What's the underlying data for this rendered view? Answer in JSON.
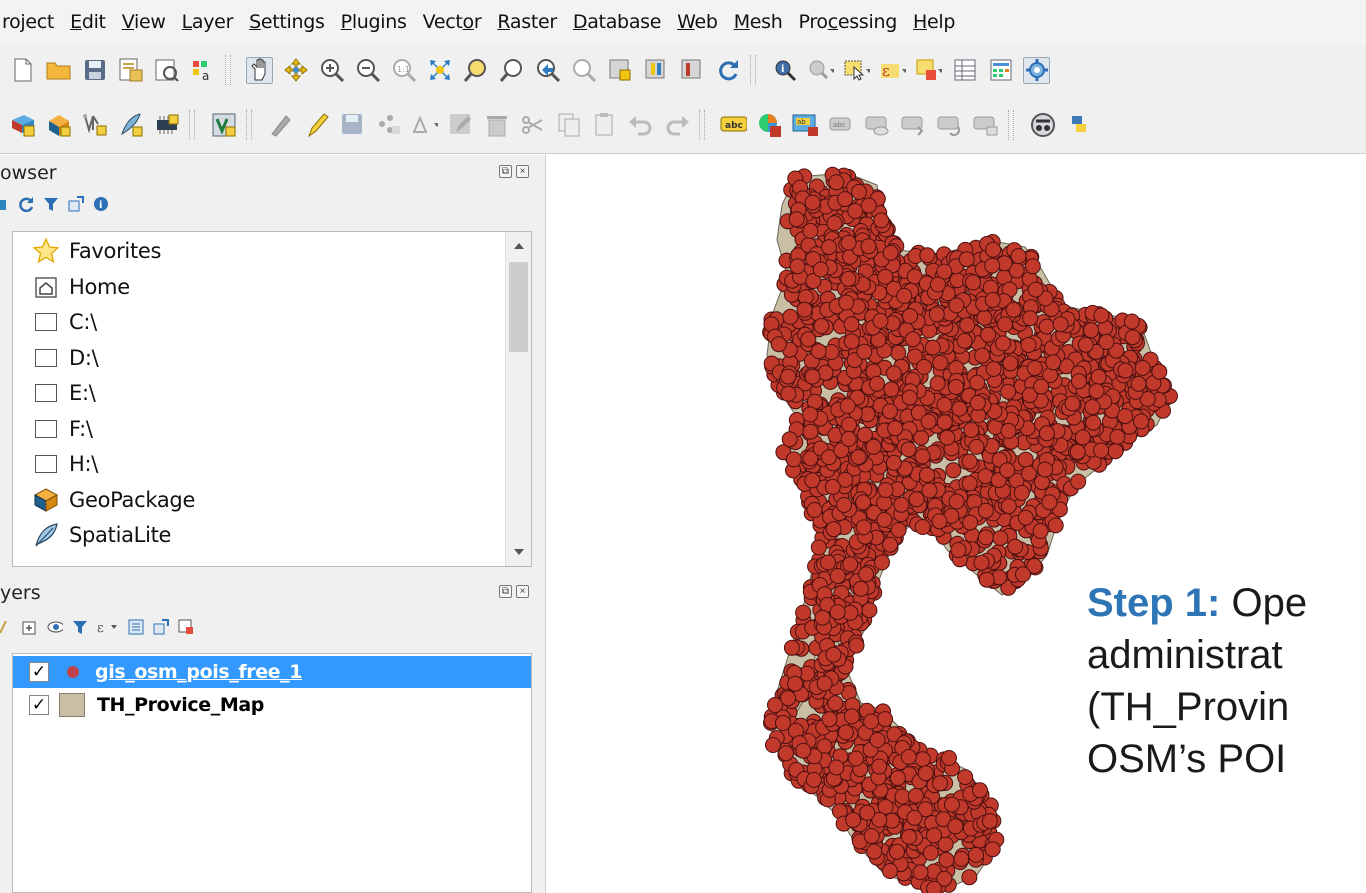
{
  "menu": [
    {
      "pre": "",
      "ul": "",
      "post": "roject"
    },
    {
      "pre": "",
      "ul": "E",
      "post": "dit"
    },
    {
      "pre": "",
      "ul": "V",
      "post": "iew"
    },
    {
      "pre": "",
      "ul": "L",
      "post": "ayer"
    },
    {
      "pre": "",
      "ul": "S",
      "post": "ettings"
    },
    {
      "pre": "",
      "ul": "P",
      "post": "lugins"
    },
    {
      "pre": "Vect",
      "ul": "o",
      "post": "r"
    },
    {
      "pre": "",
      "ul": "R",
      "post": "aster"
    },
    {
      "pre": "",
      "ul": "D",
      "post": "atabase"
    },
    {
      "pre": "",
      "ul": "W",
      "post": "eb"
    },
    {
      "pre": "",
      "ul": "M",
      "post": "esh"
    },
    {
      "pre": "Pro",
      "ul": "c",
      "post": "essing"
    },
    {
      "pre": "",
      "ul": "H",
      "post": "elp"
    }
  ],
  "browser": {
    "title": "owser",
    "items": [
      {
        "label": "Favorites",
        "icon": "star-icon"
      },
      {
        "label": "Home",
        "icon": "home-icon"
      },
      {
        "label": "C:\\",
        "icon": "folder-icon"
      },
      {
        "label": "D:\\",
        "icon": "folder-icon"
      },
      {
        "label": "E:\\",
        "icon": "folder-icon"
      },
      {
        "label": "F:\\",
        "icon": "folder-icon"
      },
      {
        "label": "H:\\",
        "icon": "folder-icon"
      },
      {
        "label": "GeoPackage",
        "icon": "geopackage-icon"
      },
      {
        "label": "SpatiaLite",
        "icon": "feather-icon"
      }
    ]
  },
  "layers": {
    "title": "yers",
    "items": [
      {
        "name": "gis_osm_pois_free_1",
        "checked": true,
        "selected": true,
        "symbol_color": "#c0424b"
      },
      {
        "name": "TH_Provice_Map",
        "checked": true,
        "selected": false,
        "symbol_color": "#c8bfa5"
      }
    ]
  },
  "map": {
    "point_color": "#c0392b",
    "point_stroke": "#4a1010",
    "polygon_color": "#c8bfa5"
  },
  "annotation": {
    "step_label": "Step 1:",
    "step_text_1": " Ope",
    "line2": "administrat",
    "line3": "(TH_Provin",
    "line4": "OSM’s POI"
  },
  "colors": {
    "selection": "#3399ff",
    "step_blue": "#2e75b6"
  }
}
